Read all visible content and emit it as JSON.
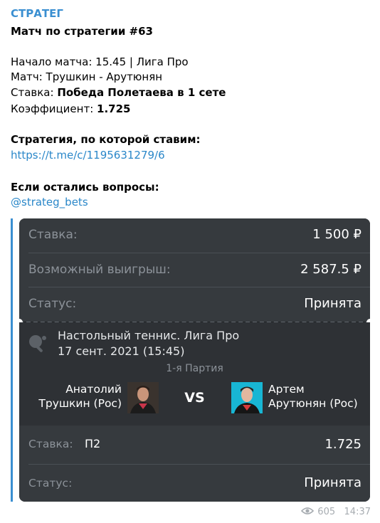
{
  "channel": "СТРАТЕГ",
  "title": "Матч по стратегии #63",
  "start": "Начало матча: 15.45 | Лига Про",
  "match_line": "Матч:  Трушкин - Арутюнян",
  "bet_label": "Ставка: ",
  "bet_value": "Победа Полетаева в 1 сете",
  "coef_label": "Коэффициент: ",
  "coef_value": "1.725",
  "strategy_label": "Стратегия, по которой ставим:",
  "strategy_link": "https://t.me/c/1195631279/6",
  "questions_label": "Если остались вопросы:",
  "questions_link": "@strateg_bets",
  "card": {
    "rows": [
      {
        "label": "Ставка:",
        "value": "1 500 ₽"
      },
      {
        "label": "Возможный выигрыш:",
        "value": "2 587.5 ₽"
      },
      {
        "label": "Статус:",
        "value": "Принята"
      }
    ],
    "match_title": "Настольный теннис. Лига Про",
    "match_date": "17 сент. 2021 (15:45)",
    "part": "1-я Партия",
    "player1_line1": "Анатолий",
    "player1_line2": "Трушкин (Рос)",
    "vs": "VS",
    "player2_line1": "Артем",
    "player2_line2": "Арутюнян (Рос)",
    "bottom_bet_label": "Ставка:",
    "bottom_bet_selection": "П2",
    "bottom_bet_coef": "1.725",
    "bottom_status_label": "Статус:",
    "bottom_status_value": "Принята"
  },
  "views": "605",
  "time": "14:37",
  "icons": {
    "sport": "ping-pong-icon",
    "views": "eye-icon"
  },
  "colors": {
    "link": "#2a87c9",
    "card_bg": "#363a3e",
    "quote_bar": "#3a8fd1"
  }
}
